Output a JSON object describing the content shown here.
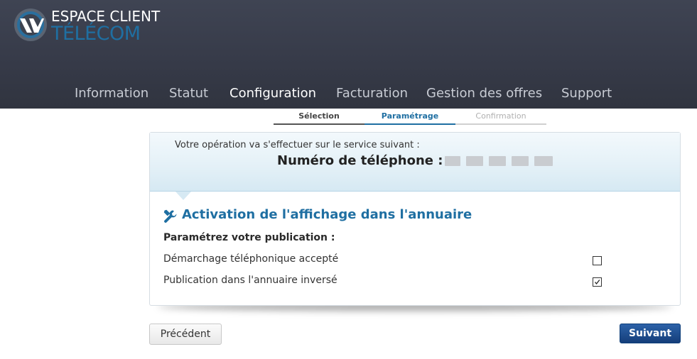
{
  "header": {
    "logo_line1": "ESPACE CLIENT",
    "logo_line2": "TÉLÉCOM",
    "logo_icon": "v-telecom-logo-icon"
  },
  "nav": {
    "items": [
      {
        "label": "Information",
        "active": false
      },
      {
        "label": "Statut",
        "active": false
      },
      {
        "label": "Configuration",
        "active": true
      },
      {
        "label": "Facturation",
        "active": false
      },
      {
        "label": "Gestion des offres",
        "active": false
      },
      {
        "label": "Support",
        "active": false
      }
    ]
  },
  "steps": [
    {
      "label": "Sélection",
      "state": "done"
    },
    {
      "label": "Paramétrage",
      "state": "current"
    },
    {
      "label": "Confirmation",
      "state": "upcoming"
    }
  ],
  "service": {
    "intro": "Votre opération va s'effectuer sur le service suivant :",
    "number_label": "Numéro de téléphone :"
  },
  "section": {
    "icon": "wrench-icon",
    "title": "Activation de l'affichage dans l'annuaire",
    "param_label": "Paramétrez votre publication :",
    "options": [
      {
        "label": "Démarchage téléphonique accepté",
        "checked": false
      },
      {
        "label": "Publication dans l'annuaire inversé",
        "checked": true
      }
    ]
  },
  "buttons": {
    "previous": "Précédent",
    "next": "Suivant"
  },
  "colors": {
    "header_bg": "#3a3e4c",
    "accent_blue": "#1f6fa2",
    "primary_button": "#1b4a8c"
  }
}
